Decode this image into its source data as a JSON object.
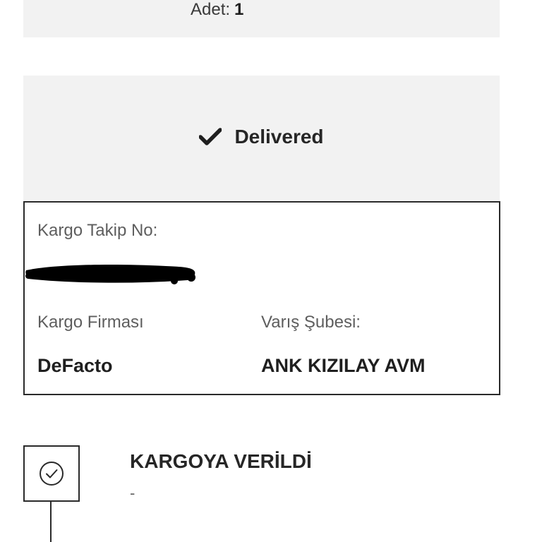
{
  "product": {
    "qty_label": "Adet:",
    "qty_value": "1"
  },
  "status": {
    "icon": "check-icon",
    "label": "Delivered"
  },
  "cargo": {
    "tracking_label": "Kargo Takip No:",
    "company_label": "Kargo Firması",
    "company_value": "DeFacto",
    "branch_label": "Varış Şubesi:",
    "branch_value": "ANK KIZILAY AVM"
  },
  "timeline": {
    "steps": [
      {
        "icon": "circle-check-icon",
        "title": "KARGOYA VERİLDİ",
        "subtitle": "-"
      }
    ]
  }
}
